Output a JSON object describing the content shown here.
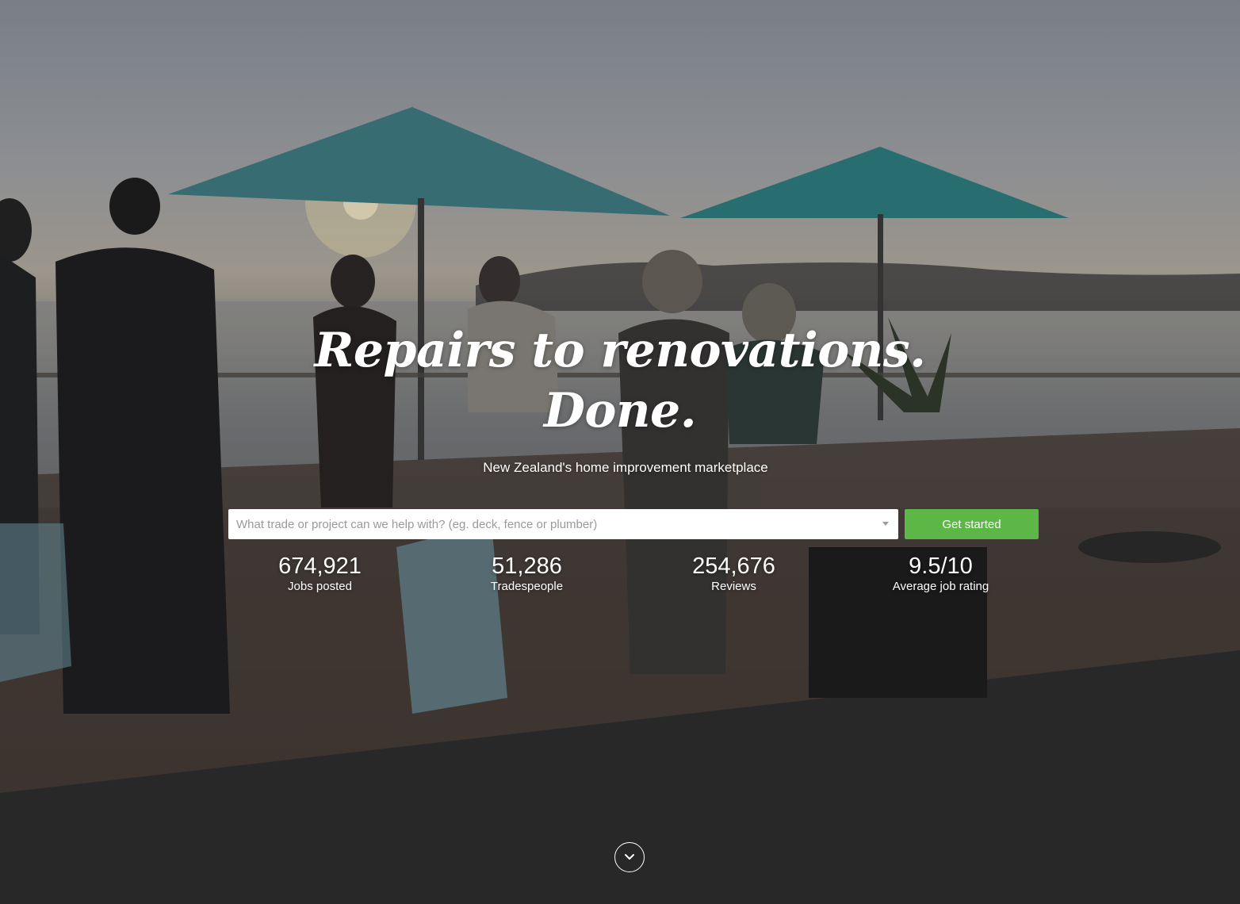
{
  "hero": {
    "headline_line1": "Repairs to renovations.",
    "headline_line2": "Done.",
    "subtitle": "New Zealand's home improvement marketplace"
  },
  "search": {
    "placeholder": "What trade or project can we help with? (eg. deck, fence or plumber)",
    "value": "",
    "dropdown_icon": "caret-down-icon"
  },
  "cta": {
    "label": "Get started",
    "color": "#5cb746"
  },
  "stats": [
    {
      "value": "674,921",
      "label": "Jobs posted"
    },
    {
      "value": "51,286",
      "label": "Tradespeople"
    },
    {
      "value": "254,676",
      "label": "Reviews"
    },
    {
      "value": "9.5/10",
      "label": "Average job rating"
    }
  ],
  "scroll_indicator": {
    "icon": "chevron-down-icon"
  }
}
